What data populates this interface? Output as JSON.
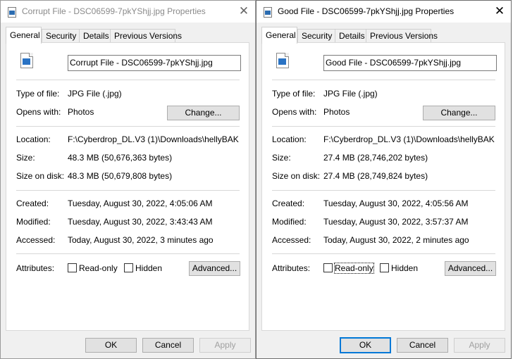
{
  "windows": [
    {
      "title": "Corrupt File - DSC06599-7pkYShjj.jpg Properties",
      "close_glyph": "✕",
      "tabs": [
        "General",
        "Security",
        "Details",
        "Previous Versions"
      ],
      "active_tab": "General",
      "filename": "Corrupt File - DSC06599-7pkYShjj.jpg",
      "type_label": "Type of file:",
      "type_value": "JPG File (.jpg)",
      "opens_label": "Opens with:",
      "opens_value": "Photos",
      "change_button": "Change...",
      "location_label": "Location:",
      "location_value": "F:\\Cyberdrop_DL.V3 (1)\\Downloads\\hellyBAK",
      "size_label": "Size:",
      "size_value": "48.3 MB (50,676,363 bytes)",
      "disk_label": "Size on disk:",
      "disk_value": "48.3 MB (50,679,808 bytes)",
      "created_label": "Created:",
      "created_value": "Tuesday, August 30, 2022, 4:05:06 AM",
      "modified_label": "Modified:",
      "modified_value": "Tuesday, August 30, 2022, 3:43:43 AM",
      "accessed_label": "Accessed:",
      "accessed_value": "Today, August 30, 2022, 3 minutes ago",
      "attributes_label": "Attributes:",
      "readonly_label": "Read-only",
      "hidden_label": "Hidden",
      "readonly_checked": false,
      "hidden_checked": false,
      "advanced_button": "Advanced...",
      "ok_button": "OK",
      "cancel_button": "Cancel",
      "apply_button": "Apply"
    },
    {
      "title": "Good File - DSC06599-7pkYShjj.jpg Properties",
      "close_glyph": "✕",
      "tabs": [
        "General",
        "Security",
        "Details",
        "Previous Versions"
      ],
      "active_tab": "General",
      "filename": "Good File - DSC06599-7pkYShjj.jpg",
      "type_label": "Type of file:",
      "type_value": "JPG File (.jpg)",
      "opens_label": "Opens with:",
      "opens_value": "Photos",
      "change_button": "Change...",
      "location_label": "Location:",
      "location_value": "F:\\Cyberdrop_DL.V3 (1)\\Downloads\\hellyBAK",
      "size_label": "Size:",
      "size_value": "27.4 MB (28,746,202 bytes)",
      "disk_label": "Size on disk:",
      "disk_value": "27.4 MB (28,749,824 bytes)",
      "created_label": "Created:",
      "created_value": "Tuesday, August 30, 2022, 4:05:56 AM",
      "modified_label": "Modified:",
      "modified_value": "Tuesday, August 30, 2022, 3:57:37 AM",
      "accessed_label": "Accessed:",
      "accessed_value": "Today, August 30, 2022, 2 minutes ago",
      "attributes_label": "Attributes:",
      "readonly_label": "Read-only",
      "hidden_label": "Hidden",
      "readonly_checked": false,
      "hidden_checked": false,
      "advanced_button": "Advanced...",
      "ok_button": "OK",
      "cancel_button": "Cancel",
      "apply_button": "Apply"
    }
  ]
}
